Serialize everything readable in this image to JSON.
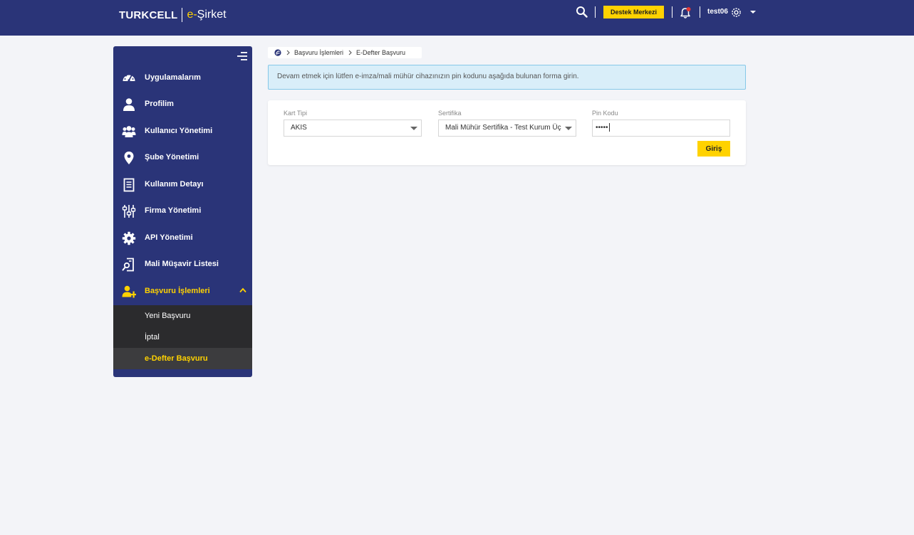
{
  "header": {
    "brand": "TURKCELL",
    "product_prefix": "e-",
    "product_name": "Şirket",
    "support_label": "Destek Merkezi",
    "username": "test06",
    "colors": {
      "bar": "#2a3478",
      "accent": "#ffd200",
      "notification_dot": "#e53935"
    }
  },
  "sidebar": {
    "items": [
      {
        "label": "Uygulamalarım",
        "icon": "speedometer-icon"
      },
      {
        "label": "Profilim",
        "icon": "user-icon"
      },
      {
        "label": "Kullanıcı Yönetimi",
        "icon": "users-group-icon"
      },
      {
        "label": "Şube Yönetimi",
        "icon": "map-pin-icon"
      },
      {
        "label": "Kullanım Detayı",
        "icon": "document-icon"
      },
      {
        "label": "Firma Yönetimi",
        "icon": "sliders-icon"
      },
      {
        "label": "API Yönetimi",
        "icon": "gear-icon"
      },
      {
        "label": "Mali Müşavir Listesi",
        "icon": "search-document-icon"
      },
      {
        "label": "Başvuru İşlemleri",
        "icon": "user-add-icon",
        "active": true,
        "expanded": true
      }
    ],
    "submenu": [
      {
        "label": "Yeni Başvuru"
      },
      {
        "label": "İptal"
      },
      {
        "label": "e-Defter Başvuru",
        "active": true
      }
    ]
  },
  "breadcrumb": {
    "items": [
      "Başvuru İşlemleri",
      "E-Defter Başvuru"
    ]
  },
  "alert": {
    "message": "Devam etmek için lütfen e-imza/mali mühür cihazınızın pin kodunu aşağıda bulunan forma girin."
  },
  "form": {
    "card_type_label": "Kart Tipi",
    "card_type_value": "AKIS",
    "certificate_label": "Sertifika",
    "certificate_value": "Mali Mühür Sertifika - Test Kurum Üç",
    "pin_label": "Pin Kodu",
    "pin_value": "•••••",
    "submit_label": "Giriş"
  }
}
